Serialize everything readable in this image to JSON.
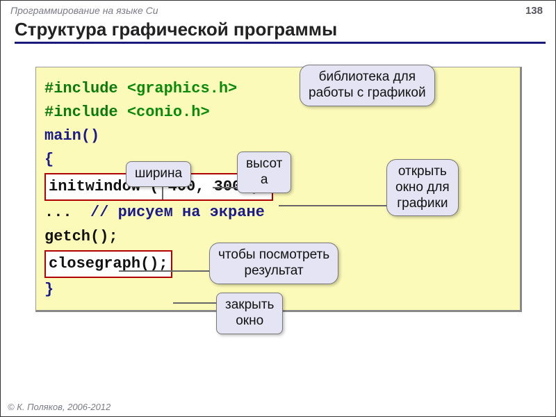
{
  "header": {
    "doc_title": "Программирование на языке Си",
    "page": "138"
  },
  "title": "Структура графической программы",
  "code": {
    "l1a": "#include ",
    "l1b": "<graphics.h>",
    "l2a": "#include ",
    "l2b": "<conio.h>",
    "l3": "main()",
    "l4": "{",
    "l5": "initwindow ( 400, 300 );",
    "l6a": "...  ",
    "l6b": "// рисуем на экране",
    "l7": "getch();",
    "l8": "closegraph();",
    "l9": "}"
  },
  "callouts": {
    "lib": "библиотека для\nработы с графикой",
    "width": "ширина",
    "height": "высот\nа",
    "open": "открыть\nокно для\nграфики",
    "result": "чтобы посмотреть\nрезультат",
    "close": "закрыть\nокно"
  },
  "footer": "© К. Поляков, 2006-2012"
}
